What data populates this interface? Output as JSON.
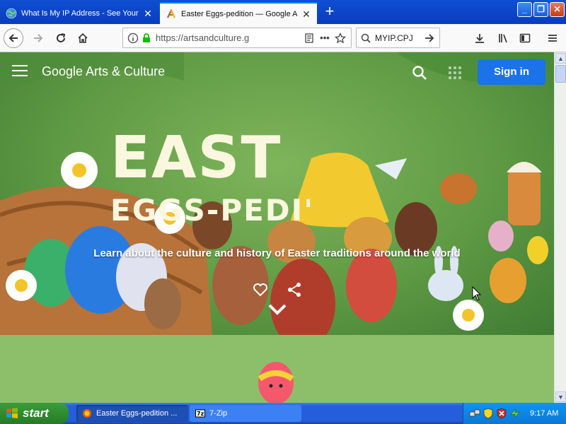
{
  "browser": {
    "tabs": [
      {
        "title": "What Is My IP Address - See Your",
        "active": false
      },
      {
        "title": "Easter Eggs-pedition — Google Arts",
        "active": true
      }
    ],
    "new_tab_icon": "plus-icon",
    "window_controls": [
      "minimize",
      "maximize",
      "close"
    ],
    "url": "https://artsandculture.g",
    "search_value": "MYIP.CPJ"
  },
  "site": {
    "brand": "Google Arts & Culture",
    "sign_in_label": "Sign in",
    "hero": {
      "title_line1": "EAST",
      "title_line2": "EGGS-PEDI'",
      "subtitle": "Learn about the culture and history of Easter traditions around the world"
    },
    "accent_color": "#1a73e8"
  },
  "taskbar": {
    "start_label": "start",
    "tasks": [
      {
        "label": "Easter Eggs-pedition ...",
        "active": true
      },
      {
        "label": "7-Zip",
        "active": false
      }
    ],
    "clock": "9:17 AM"
  }
}
